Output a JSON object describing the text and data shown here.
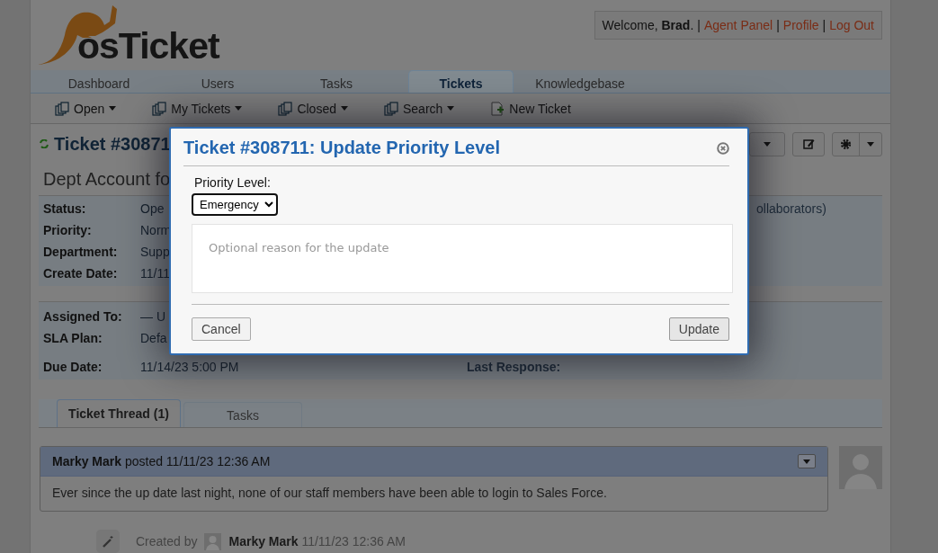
{
  "header": {
    "logo": "osTicket",
    "user_bar": [
      {
        "kind": "text",
        "text": "Welcome, **Brad**."
      },
      {
        "kind": "sep",
        "text": "|"
      },
      {
        "kind": "link",
        "text": "Agent Panel"
      },
      {
        "kind": "sep",
        "text": "|"
      },
      {
        "kind": "link",
        "text": "Profile"
      },
      {
        "kind": "sep",
        "text": "|"
      },
      {
        "kind": "link",
        "text": "Log Out"
      }
    ]
  },
  "nav_tabs": [
    {
      "label": "Dashboard",
      "selected": false
    },
    {
      "label": "Users",
      "selected": false
    },
    {
      "label": "Tasks",
      "selected": false
    },
    {
      "label": "Tickets",
      "selected": true
    },
    {
      "label": "Knowledgebase",
      "selected": false
    }
  ],
  "sub_nav": [
    {
      "label": "Open",
      "kind": "queue",
      "has_menu": true
    },
    {
      "label": "My Tickets",
      "kind": "queue",
      "has_menu": true
    },
    {
      "label": "Closed",
      "kind": "queue",
      "has_menu": true
    },
    {
      "label": "Search",
      "kind": "queue",
      "has_menu": true
    },
    {
      "label": "New Ticket",
      "kind": "new",
      "has_menu": false
    }
  ],
  "ticket": {
    "title": "Ticket #30871",
    "subject": "Dept Account fo",
    "details": [
      {
        "label": "Status:",
        "value": "Ope"
      },
      {
        "label": "Priority:",
        "value": "Norm"
      },
      {
        "label": "Department:",
        "value": "Supp"
      },
      {
        "label": "Create Date:",
        "value": "11/11"
      }
    ],
    "details_right": "ollaborators)",
    "assignment": [
      {
        "label": "Assigned To:",
        "value": "— U"
      },
      {
        "label": "SLA Plan:",
        "value": "Defa"
      },
      {
        "label": "Due Date:",
        "value": "11/14/23 5:00 PM"
      }
    ],
    "assignment_right": "Last Response:"
  },
  "thread_tabs": [
    {
      "label": "Ticket Thread (1)",
      "selected": true
    },
    {
      "label": "Tasks",
      "selected": false
    }
  ],
  "thread": {
    "header": "**Marky Mark** posted 11/11/23 12:36 AM",
    "body": "Ever since the up date last night, none of our staff members have been able to login to Sales Force.",
    "event_prefix": "Created by",
    "event_text": "**Marky Mark** 11/11/23 12:36 AM"
  },
  "dialog": {
    "title": "Ticket #308711: Update Priority Level",
    "field_label": "Priority Level:",
    "value": "Emergency",
    "placeholder": "Optional reason for the update",
    "buttons": [
      {
        "label": "Cancel",
        "kind": "cancel"
      },
      {
        "label": "Update",
        "kind": "submit"
      }
    ]
  }
}
